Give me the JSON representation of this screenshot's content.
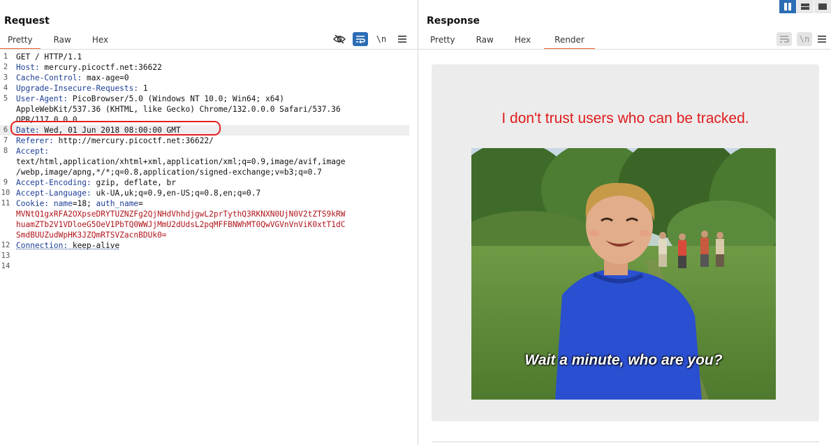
{
  "request": {
    "title": "Request",
    "tabs": [
      {
        "label": "Pretty",
        "active": true
      },
      {
        "label": "Raw",
        "active": false
      },
      {
        "label": "Hex",
        "active": false
      }
    ],
    "toolbar": {
      "hide_icon": "eye-slash-icon",
      "wrap_icon": "word-wrap-icon",
      "newline_label": "\\n",
      "menu_icon": "hamburger-menu-icon"
    },
    "lines": [
      {
        "n": "1",
        "key": "",
        "val": "GET / HTTP/1.1"
      },
      {
        "n": "2",
        "key": "Host:",
        "val": " mercury.picoctf.net:36622"
      },
      {
        "n": "3",
        "key": "Cache-Control:",
        "val": " max-age=0"
      },
      {
        "n": "4",
        "key": "Upgrade-Insecure-Requests:",
        "val": " 1"
      },
      {
        "n": "5",
        "key": "User-Agent:",
        "val": " PicoBrowser/5.0 (Windows NT 10.0; Win64; x64)"
      },
      {
        "n": "",
        "key": "",
        "val": "AppleWebKit/537.36 (KHTML, like Gecko) Chrome/132.0.0.0 Safari/537.36"
      },
      {
        "n": "",
        "key": "",
        "val": "OPR/117.0.0.0"
      },
      {
        "n": "6",
        "key": "Date:",
        "val": " Wed, 01 Jun 2018 08:00:00 GMT",
        "highlight": true
      },
      {
        "n": "7",
        "key": "Referer:",
        "val": " http://mercury.picoctf.net:36622/"
      },
      {
        "n": "8",
        "key": "Accept:",
        "val": ""
      },
      {
        "n": "",
        "key": "",
        "val": "text/html,application/xhtml+xml,application/xml;q=0.9,image/avif,image"
      },
      {
        "n": "",
        "key": "",
        "val": "/webp,image/apng,*/*;q=0.8,application/signed-exchange;v=b3;q=0.7"
      },
      {
        "n": "9",
        "key": "Accept-Encoding:",
        "val": " gzip, deflate, br"
      },
      {
        "n": "10",
        "key": "Accept-Language:",
        "val": " uk-UA,uk;q=0.9,en-US;q=0.8,en;q=0.7"
      },
      {
        "n": "11",
        "key": "Cookie:",
        "val": " ",
        "cookie": true,
        "ck1": "name",
        "cv1": "=18; ",
        "ck2": "auth_name",
        "cv2": "="
      },
      {
        "n": "",
        "key": "",
        "val": "MVNtQ1gxRFA2OXpseDRYTUZNZFg2QjNHdVhhdjgwL2prTythQ3RKNXN0UjN0V2tZTS9kRW",
        "redline": true
      },
      {
        "n": "",
        "key": "",
        "val": "huamZTb2V1VDloeG5OeV1PbTQ0WWJjMmU2dUdsL2pqMFFBNWhMT0QwVGVnVnViK0xtT1dC",
        "redline": true
      },
      {
        "n": "",
        "key": "",
        "val": "SmdBUUZudWpHK3JZQmRTSVZacnBDUk0=",
        "redline": true
      },
      {
        "n": "12",
        "key": "Connection:",
        "val": " keep-alive",
        "conn": true
      },
      {
        "n": "13",
        "key": "",
        "val": ""
      },
      {
        "n": "14",
        "key": "",
        "val": ""
      }
    ]
  },
  "response": {
    "title": "Response",
    "tabs": [
      {
        "label": "Pretty",
        "active": false
      },
      {
        "label": "Raw",
        "active": false
      },
      {
        "label": "Hex",
        "active": false
      },
      {
        "label": "Render",
        "active": true
      }
    ],
    "toolbar": {
      "wrap_icon": "word-wrap-icon",
      "newline_label": "\\n",
      "menu_icon": "hamburger-menu-icon"
    },
    "render": {
      "heading": "I don't trust users who can be tracked.",
      "gif_caption": "Wait a minute, who are you?"
    }
  },
  "layout_buttons": [
    {
      "icon": "split-columns-icon",
      "active": true
    },
    {
      "icon": "split-rows-icon",
      "active": false
    },
    {
      "icon": "single-pane-icon",
      "active": false
    }
  ],
  "colors": {
    "accent_tab": "#e8662b",
    "active_button": "#2c6db5",
    "header_key": "#1c3f97",
    "cookie_value": "#b0151b",
    "render_text": "#e01b1b",
    "annotation": "#e32020"
  }
}
